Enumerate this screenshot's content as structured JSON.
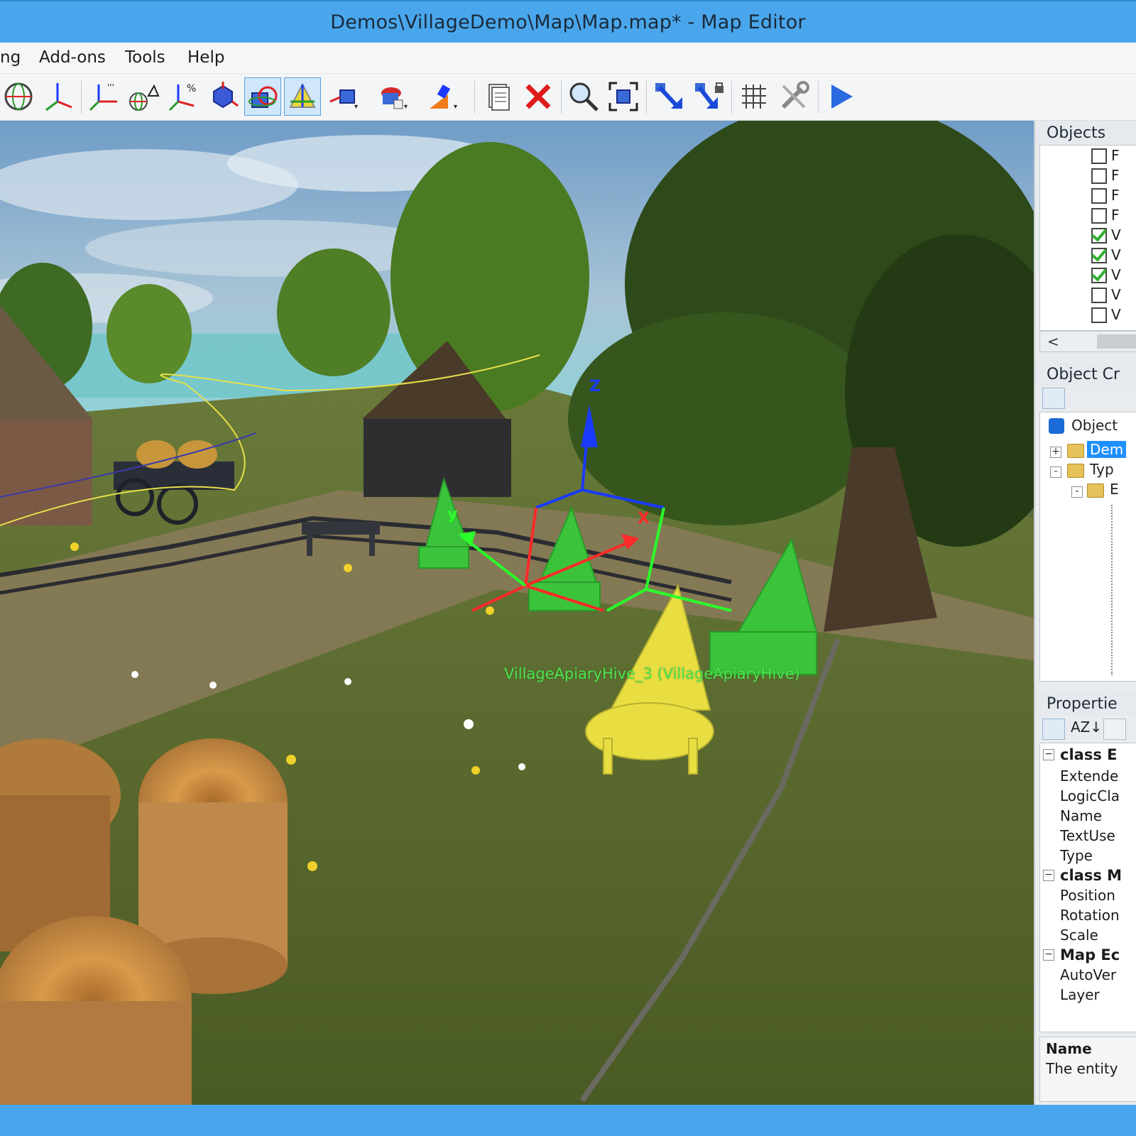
{
  "window": {
    "title": "Demos\\VillageDemo\\Map\\Map.map* - Map Editor"
  },
  "menu": {
    "items": [
      "ng",
      "Add-ons",
      "Tools",
      "Help"
    ]
  },
  "toolbar": {
    "buttons": [
      "transform-sphere-icon",
      "move-axis-icon",
      "position-axis-icon",
      "rotate-axis-icon",
      "scale-axis-icon",
      "snap-tool-icon",
      "select-tool-icon",
      "grid-align-icon",
      "create-object-icon",
      "add-mesh-icon",
      "add-light-icon",
      "copy-icon",
      "delete-icon",
      "search-icon",
      "focus-camera-icon",
      "drop-to-floor-icon",
      "lock-down-icon",
      "grid-icon",
      "settings-tools-icon",
      "run-simulation-icon"
    ]
  },
  "viewport": {
    "selected_entity_label": "VillageApiaryHive_3 (VillageApiaryHive)",
    "gizmo_axes": {
      "x": "X",
      "y": "y",
      "z": "Z"
    },
    "colors": {
      "x_axis": "#ff2a2a",
      "y_axis": "#2aff2a",
      "z_axis": "#1a3aff",
      "selection": "#58e058",
      "highlight": "#e8e04a"
    }
  },
  "objects_panel": {
    "header": "Objects",
    "rows": [
      {
        "checked": false,
        "label": "F"
      },
      {
        "checked": false,
        "label": "F"
      },
      {
        "checked": false,
        "label": "F"
      },
      {
        "checked": false,
        "label": "F"
      },
      {
        "checked": true,
        "label": "V"
      },
      {
        "checked": true,
        "label": "V"
      },
      {
        "checked": true,
        "label": "V"
      },
      {
        "checked": false,
        "label": "V"
      },
      {
        "checked": false,
        "label": "V"
      }
    ],
    "scroll_left": "<"
  },
  "object_creation_panel": {
    "header": "Object Cr",
    "tree": {
      "root": "Object",
      "items": [
        {
          "label": "Dem",
          "selected": true,
          "expander": "+"
        },
        {
          "label": "Typ",
          "selected": false,
          "expander": "-"
        },
        {
          "label": "E",
          "selected": false,
          "expander": "-"
        }
      ]
    }
  },
  "properties_panel": {
    "header": "Propertie",
    "sort_button": "AZ↓",
    "categories": [
      {
        "name": "class E",
        "items": [
          "Extende",
          "LogicCla",
          "Name",
          "TextUse",
          "Type"
        ]
      },
      {
        "name": "class M",
        "items": [
          "Position",
          "Rotation",
          "Scale"
        ]
      },
      {
        "name": "Map Ec",
        "items": [
          "AutoVer",
          "Layer"
        ]
      }
    ],
    "description": {
      "title": "Name",
      "text": "The entity"
    }
  }
}
